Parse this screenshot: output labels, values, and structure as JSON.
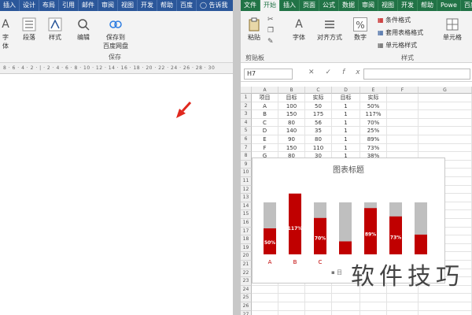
{
  "word": {
    "tabs": [
      "插入",
      "设计",
      "布局",
      "引用",
      "邮件",
      "审阅",
      "视图",
      "开发",
      "帮助",
      "百度",
      "告诉我"
    ],
    "ribbon": {
      "font_label": "字体",
      "paragraph_label": "段落",
      "style_label": "样式",
      "edit_label": "编辑",
      "save_baidu_line1": "保存到",
      "save_baidu_line2": "百度网盘",
      "save_group": "保存"
    },
    "ruler_text": "8 · 6 · 4 · 2 · | · 2 · 4 · 6 · 8 · 10 · 12 · 14 · 16 · 18 · 20 · 22 · 24 · 26 · 28 · 30"
  },
  "excel": {
    "tabs": [
      "文件",
      "开始",
      "插入",
      "页面",
      "公式",
      "数据",
      "审阅",
      "视图",
      "开发",
      "帮助",
      "Powe",
      "百度"
    ],
    "active_tab": "开始",
    "ribbon": {
      "paste_label": "粘贴",
      "clipboard_label": "剪贴板",
      "font_label": "字体",
      "align_label": "对齐方式",
      "number_label": "数字",
      "cond_format": "条件格式",
      "table_format": "套用表格格式",
      "cell_style": "单元格样式",
      "style_group": "样式",
      "cells_label": "单元格"
    },
    "name_box": "H7",
    "fx": "fx",
    "columns": [
      "A",
      "B",
      "C",
      "D",
      "E",
      "F",
      "G"
    ],
    "rows": [
      "1",
      "2",
      "3",
      "4",
      "5",
      "6",
      "7",
      "8",
      "9",
      "10",
      "11",
      "12",
      "13",
      "14",
      "15",
      "16",
      "17",
      "18",
      "19",
      "20",
      "21",
      "22",
      "23",
      "24",
      "25",
      "26",
      "27"
    ],
    "table": {
      "headers": [
        "项目",
        "目标",
        "实际",
        "目标",
        "实际"
      ],
      "data": [
        [
          "A",
          "100",
          "50",
          "1",
          "50%"
        ],
        [
          "B",
          "150",
          "175",
          "1",
          "117%"
        ],
        [
          "C",
          "80",
          "56",
          "1",
          "70%"
        ],
        [
          "D",
          "140",
          "35",
          "1",
          "25%"
        ],
        [
          "E",
          "90",
          "80",
          "1",
          "89%"
        ],
        [
          "F",
          "150",
          "110",
          "1",
          "73%"
        ],
        [
          "G",
          "80",
          "30",
          "1",
          "38%"
        ]
      ]
    }
  },
  "chart_data": {
    "type": "bar",
    "title": "图表标题",
    "categories": [
      "A",
      "B",
      "C",
      "D",
      "E",
      "F",
      "G"
    ],
    "visible_category_labels": [
      "A",
      "B",
      "C"
    ],
    "series": [
      {
        "values": [
          1,
          1,
          1,
          1,
          1,
          1,
          1
        ],
        "color": "#bfbfbf"
      },
      {
        "values": [
          0.5,
          1.17,
          0.7,
          0.25,
          0.89,
          0.73,
          0.38
        ],
        "color": "#c00000"
      }
    ],
    "data_labels": [
      "50%",
      "117%",
      "70%",
      "",
      "89%",
      "73%",
      ""
    ],
    "legend_text": "目"
  },
  "watermark": "软件技巧",
  "colors": {
    "word_blue": "#2b579a",
    "excel_green": "#217346",
    "bar_red": "#c00000",
    "bar_grey": "#bfbfbf"
  }
}
